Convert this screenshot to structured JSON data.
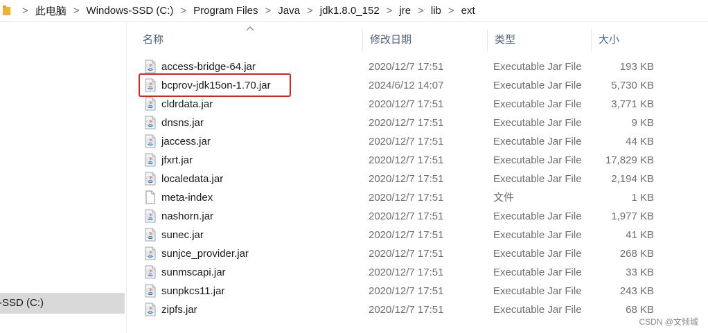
{
  "breadcrumb": [
    "此电脑",
    "Windows-SSD (C:)",
    "Program Files",
    "Java",
    "jdk1.8.0_152",
    "jre",
    "lib",
    "ext"
  ],
  "breadcrumb_separator": ">",
  "nav": {
    "selected_item": "-SSD (C:)"
  },
  "columns": {
    "name": "名称",
    "date": "修改日期",
    "type": "类型",
    "size": "大小"
  },
  "files": [
    {
      "name": "access-bridge-64.jar",
      "date": "2020/12/7 17:51",
      "type": "Executable Jar File",
      "size": "193 KB",
      "icon": "java-jar-icon"
    },
    {
      "name": "bcprov-jdk15on-1.70.jar",
      "date": "2024/6/12 14:07",
      "type": "Executable Jar File",
      "size": "5,730 KB",
      "icon": "java-jar-icon"
    },
    {
      "name": "cldrdata.jar",
      "date": "2020/12/7 17:51",
      "type": "Executable Jar File",
      "size": "3,771 KB",
      "icon": "java-jar-icon"
    },
    {
      "name": "dnsns.jar",
      "date": "2020/12/7 17:51",
      "type": "Executable Jar File",
      "size": "9 KB",
      "icon": "java-jar-icon"
    },
    {
      "name": "jaccess.jar",
      "date": "2020/12/7 17:51",
      "type": "Executable Jar File",
      "size": "44 KB",
      "icon": "java-jar-icon"
    },
    {
      "name": "jfxrt.jar",
      "date": "2020/12/7 17:51",
      "type": "Executable Jar File",
      "size": "17,829 KB",
      "icon": "java-jar-icon"
    },
    {
      "name": "localedata.jar",
      "date": "2020/12/7 17:51",
      "type": "Executable Jar File",
      "size": "2,194 KB",
      "icon": "java-jar-icon"
    },
    {
      "name": "meta-index",
      "date": "2020/12/7 17:51",
      "type": "文件",
      "size": "1 KB",
      "icon": "blank-file-icon"
    },
    {
      "name": "nashorn.jar",
      "date": "2020/12/7 17:51",
      "type": "Executable Jar File",
      "size": "1,977 KB",
      "icon": "java-jar-icon"
    },
    {
      "name": "sunec.jar",
      "date": "2020/12/7 17:51",
      "type": "Executable Jar File",
      "size": "41 KB",
      "icon": "java-jar-icon"
    },
    {
      "name": "sunjce_provider.jar",
      "date": "2020/12/7 17:51",
      "type": "Executable Jar File",
      "size": "268 KB",
      "icon": "java-jar-icon"
    },
    {
      "name": "sunmscapi.jar",
      "date": "2020/12/7 17:51",
      "type": "Executable Jar File",
      "size": "33 KB",
      "icon": "java-jar-icon"
    },
    {
      "name": "sunpkcs11.jar",
      "date": "2020/12/7 17:51",
      "type": "Executable Jar File",
      "size": "243 KB",
      "icon": "java-jar-icon"
    },
    {
      "name": "zipfs.jar",
      "date": "2020/12/7 17:51",
      "type": "Executable Jar File",
      "size": "68 KB",
      "icon": "java-jar-icon"
    }
  ],
  "highlight_color": "#e02020",
  "watermark": "CSDN @文倾城"
}
